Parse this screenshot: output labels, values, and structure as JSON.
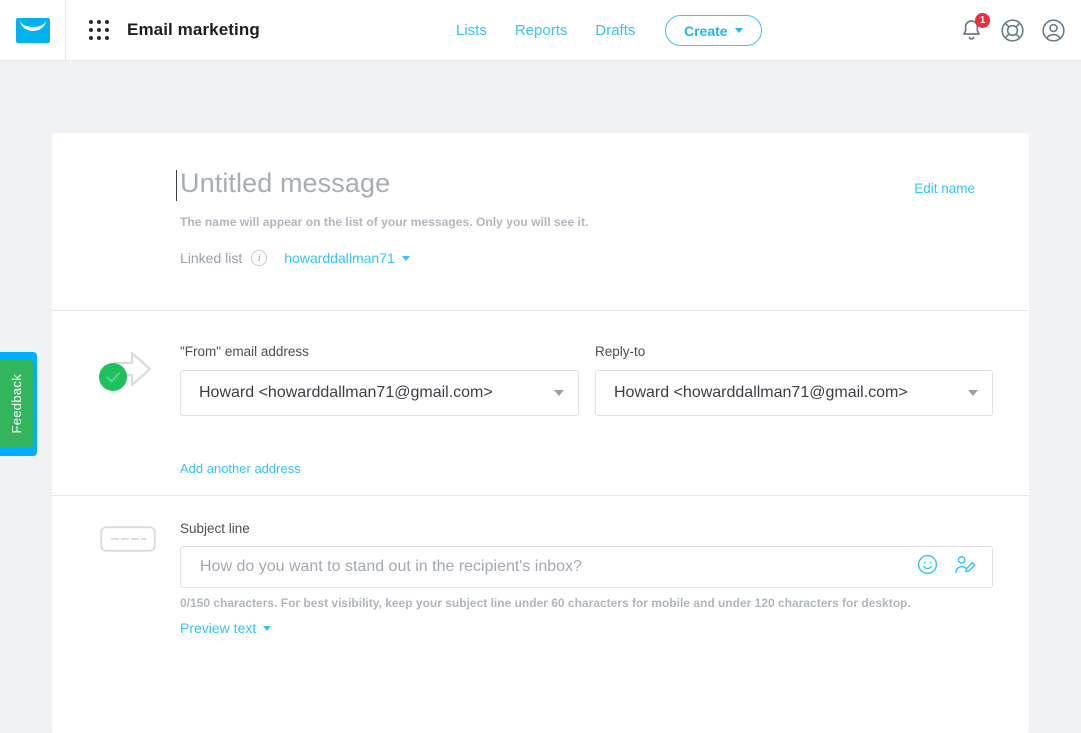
{
  "app": {
    "logo_icon": "envelope-logo-icon",
    "grid_icon": "app-grid-icon",
    "title": "Email marketing"
  },
  "nav": {
    "items": [
      {
        "label": "Lists",
        "name": "nav-lists"
      },
      {
        "label": "Reports",
        "name": "nav-reports"
      },
      {
        "label": "Drafts",
        "name": "nav-drafts"
      }
    ],
    "create_label": "Create"
  },
  "topright": {
    "notifications_icon": "bell-icon",
    "notifications_count": "1",
    "help_icon": "lifebuoy-icon",
    "account_icon": "user-avatar-icon"
  },
  "message": {
    "name_value": "Untitled message",
    "name_placeholder": "Untitled message",
    "name_hint": "The name will appear on the list of your messages. Only you will see it.",
    "edit_name_label": "Edit name",
    "linked_list_label": "Linked list",
    "linked_list_info_icon": "info-icon",
    "linked_list_value": "howarddallman71"
  },
  "from_section": {
    "status_icon": "arrow-right-check-icon",
    "from_label": "\"From\" email address",
    "from_value": "Howard <howarddallman71@gmail.com>",
    "reply_label": "Reply-to",
    "reply_value": "Howard <howarddallman71@gmail.com>",
    "add_address_label": "Add another address"
  },
  "subject_section": {
    "icon": "subject-line-icon",
    "label": "Subject line",
    "placeholder": "How do you want to stand out in the recipient's inbox?",
    "value": "",
    "emoji_icon": "smiley-icon",
    "personalize_icon": "person-edit-icon",
    "hint": "0/150 characters. For best visibility, keep your subject line under 60 characters for mobile and under 120 characters for desktop.",
    "preview_text_label": "Preview text"
  },
  "feedback": {
    "label": "Feedback"
  },
  "colors": {
    "accent_blue": "#36c3f7",
    "badge_red": "#eb2d3a",
    "status_green": "#32b55c",
    "page_bg": "#f1f2f6"
  }
}
